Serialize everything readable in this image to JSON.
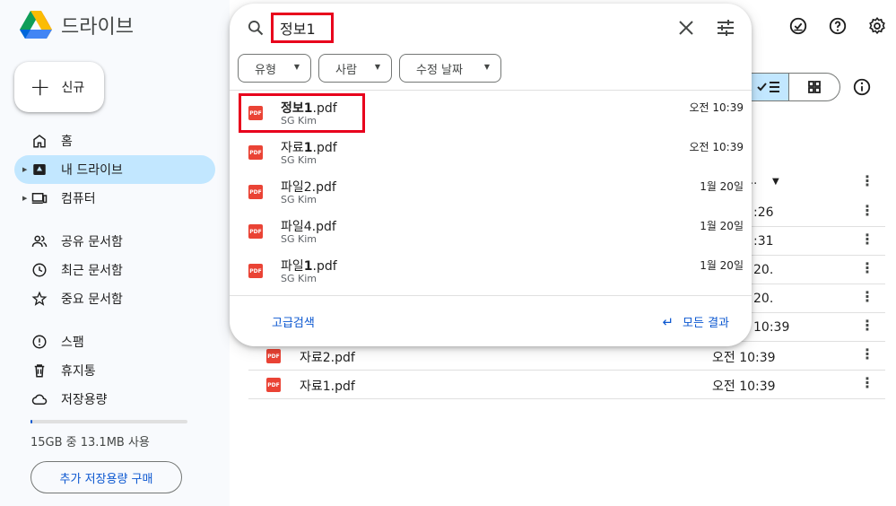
{
  "app": {
    "title": "드라이브"
  },
  "sidebar": {
    "new_label": "신규",
    "items": [
      {
        "label": "홈",
        "icon": "home-icon"
      },
      {
        "label": "내 드라이브",
        "icon": "my-drive-icon"
      },
      {
        "label": "컴퓨터",
        "icon": "computer-icon"
      },
      {
        "label": "공유 문서함",
        "icon": "shared-icon"
      },
      {
        "label": "최근 문서함",
        "icon": "recent-icon"
      },
      {
        "label": "중요 문서함",
        "icon": "star-icon"
      },
      {
        "label": "스팸",
        "icon": "spam-icon"
      },
      {
        "label": "휴지통",
        "icon": "trash-icon"
      },
      {
        "label": "저장용량",
        "icon": "cloud-icon"
      }
    ],
    "storage_text": "15GB 중 13.1MB 사용",
    "storage_fraction": 0.001,
    "buy_label": "추가 저장용량 구매"
  },
  "search": {
    "query": "정보1",
    "chips": [
      "유형",
      "사람",
      "수정 날짜"
    ],
    "results": [
      {
        "name_bold": "정보1",
        "name_rest": ".pdf",
        "owner": "SG Kim",
        "time": "오전 10:39"
      },
      {
        "name_prefix": "자료",
        "name_bold": "1",
        "name_rest": ".pdf",
        "owner": "SG Kim",
        "time": "오전 10:39"
      },
      {
        "name_prefix": "파일2.pdf",
        "owner": "SG Kim",
        "time": "1월 20일"
      },
      {
        "name_prefix": "파일4.pdf",
        "owner": "SG Kim",
        "time": "1월 20일"
      },
      {
        "name_prefix": "파일",
        "name_bold": "1",
        "name_rest": ".pdf",
        "owner": "SG Kim",
        "time": "1월 20일"
      }
    ],
    "advanced_label": "고급검색",
    "all_results_label": "모든 결과"
  },
  "list": {
    "sort_header_fragment": "..",
    "partial_dates": [
      ":26",
      ":31",
      "20.",
      "20.",
      "10:39"
    ],
    "rows": [
      {
        "name": "자료2.pdf",
        "date": "오전 10:39"
      },
      {
        "name": "자료1.pdf",
        "date": "오전 10:39"
      }
    ]
  },
  "colors": {
    "accent": "#0b57d0",
    "active_bg": "#c2e7ff",
    "highlight": "#e8001c",
    "pdf": "#ea4335"
  }
}
